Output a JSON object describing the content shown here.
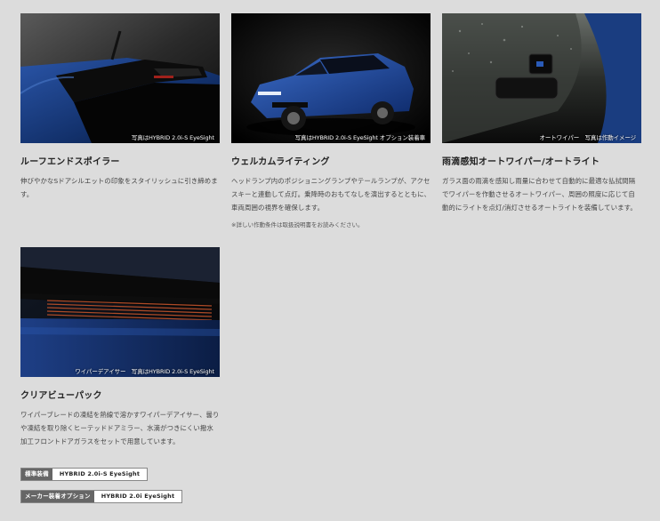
{
  "cards": [
    {
      "title": "ルーフエンドスポイラー",
      "caption": "写真はHYBRID 2.0i-S EyeSight",
      "description": "伸びやかなSドアシルエットの印象をスタイリッシュに引き締めます。"
    },
    {
      "title": "ウェルカムライティング",
      "caption": "写真はHYBRID 2.0i-S EyeSight オプション装着車",
      "description": "ヘッドランプ内のポジショニングランプやテールランプが、アクセスキーと連動して点灯。乗降時のおもてなしを演出するとともに、車両周囲の視界を確保します。",
      "note": "※詳しい作動条件は取扱説明書をお読みください。"
    },
    {
      "title": "雨滴感知オートワイパー/オートライト",
      "caption": "オートワイパー　写真は作動イメージ",
      "description": "ガラス面の雨滴を感知し雨量に合わせて自動的に最適な払拭間隔でワイパーを作動させるオートワイパー、周囲の照度に応じて自動的にライトを点灯/消灯させるオートライトを装備しています。"
    },
    {
      "title": "クリアビューパック",
      "caption": "ワイパーデアイサー　写真はHYBRID 2.0i-S EyeSight",
      "description": "ワイパーブレードの凍結を熱線で溶かすワイパーデアイサー、曇りや凍結を取り除くヒーテッドドアミラー、水滴がつきにくい撥水加工フロントドアガラスをセットで用意しています。"
    }
  ],
  "badges": [
    {
      "tag": "標準装備",
      "value": "HYBRID 2.0i-S EyeSight"
    },
    {
      "tag": "メーカー装着オプション",
      "value": "HYBRID 2.0i EyeSight"
    }
  ]
}
